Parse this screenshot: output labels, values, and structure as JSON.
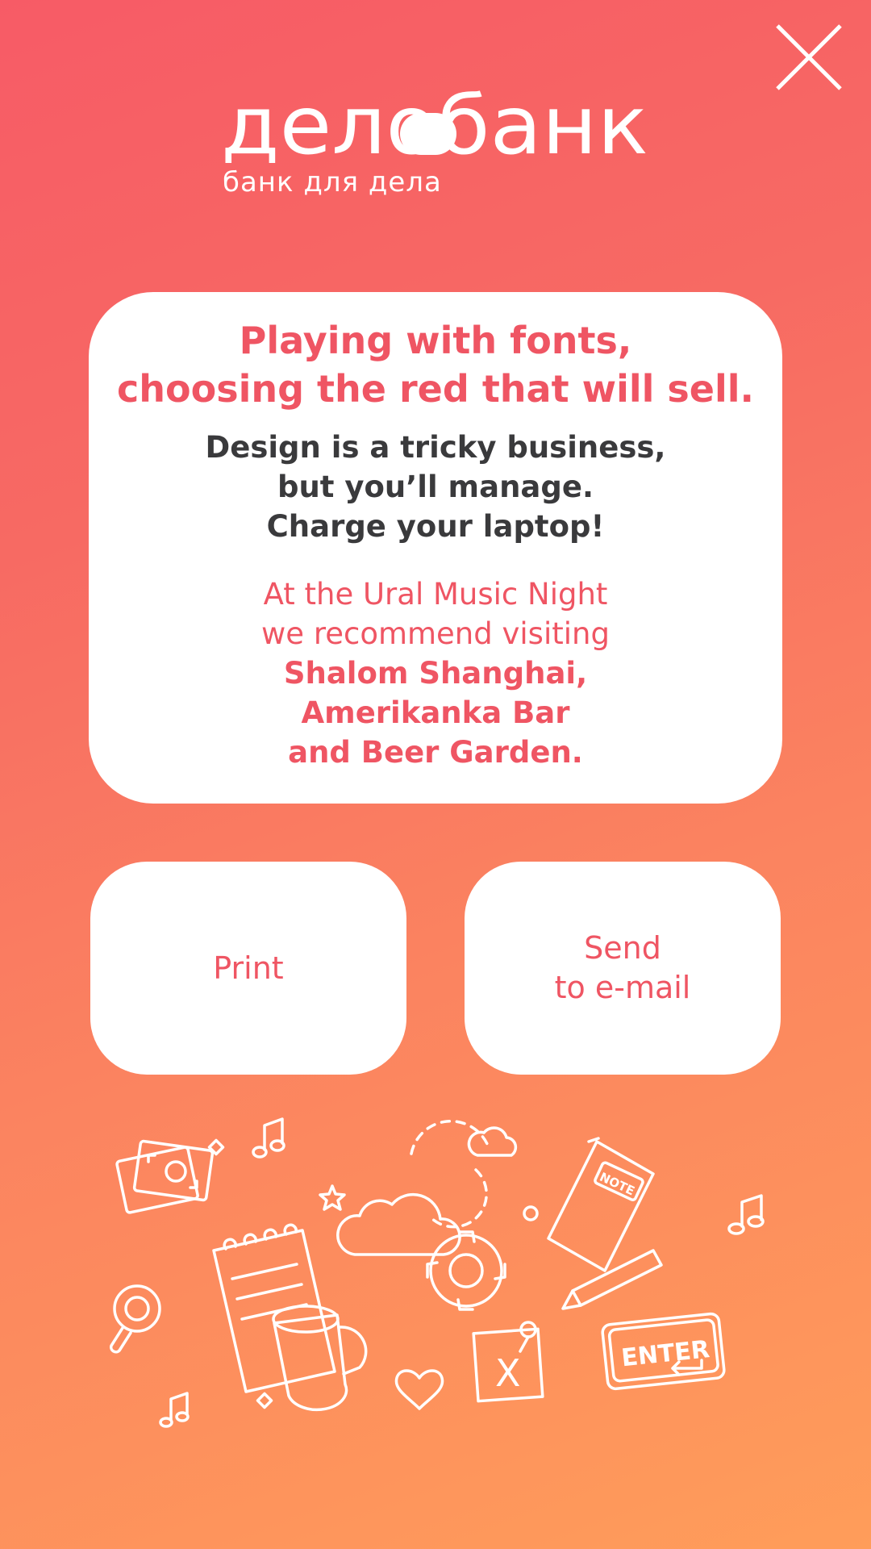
{
  "header": {
    "close_icon": "close-icon"
  },
  "logo": {
    "brand": "делобанк",
    "tagline": "банк для дела"
  },
  "card": {
    "headline": [
      "Playing with fonts,",
      "choosing the red that will sell."
    ],
    "body": [
      "Design is a tricky business,",
      "but you’ll manage.",
      "Charge your laptop!"
    ],
    "recommendation": [
      "At the Ural Music Night",
      "we recommend visiting"
    ],
    "venues": [
      "Shalom Shanghai,",
      "Amerikanka Bar",
      "and Beer Garden."
    ]
  },
  "actions": {
    "print_label": "Print",
    "email_label": [
      "Send",
      "to e-mail"
    ]
  },
  "doodles": {
    "icons": [
      "money-icon",
      "music-note-icon",
      "cloud-icon",
      "gear-icon",
      "notebook-icon",
      "pencil-icon",
      "magnifier-icon",
      "notepad-icon",
      "mug-icon",
      "sticky-note-icon",
      "heart-icon",
      "enter-key-icon",
      "star-icon"
    ],
    "note_label": "NOTE",
    "enter_label": "ENTER",
    "sticky_mark": "X"
  },
  "colors": {
    "gradient_top": "#f75b66",
    "gradient_bottom": "#ff9d5a",
    "accent_red": "#ef5563",
    "body_text": "#3a3a3c",
    "card_bg": "#ffffff"
  }
}
